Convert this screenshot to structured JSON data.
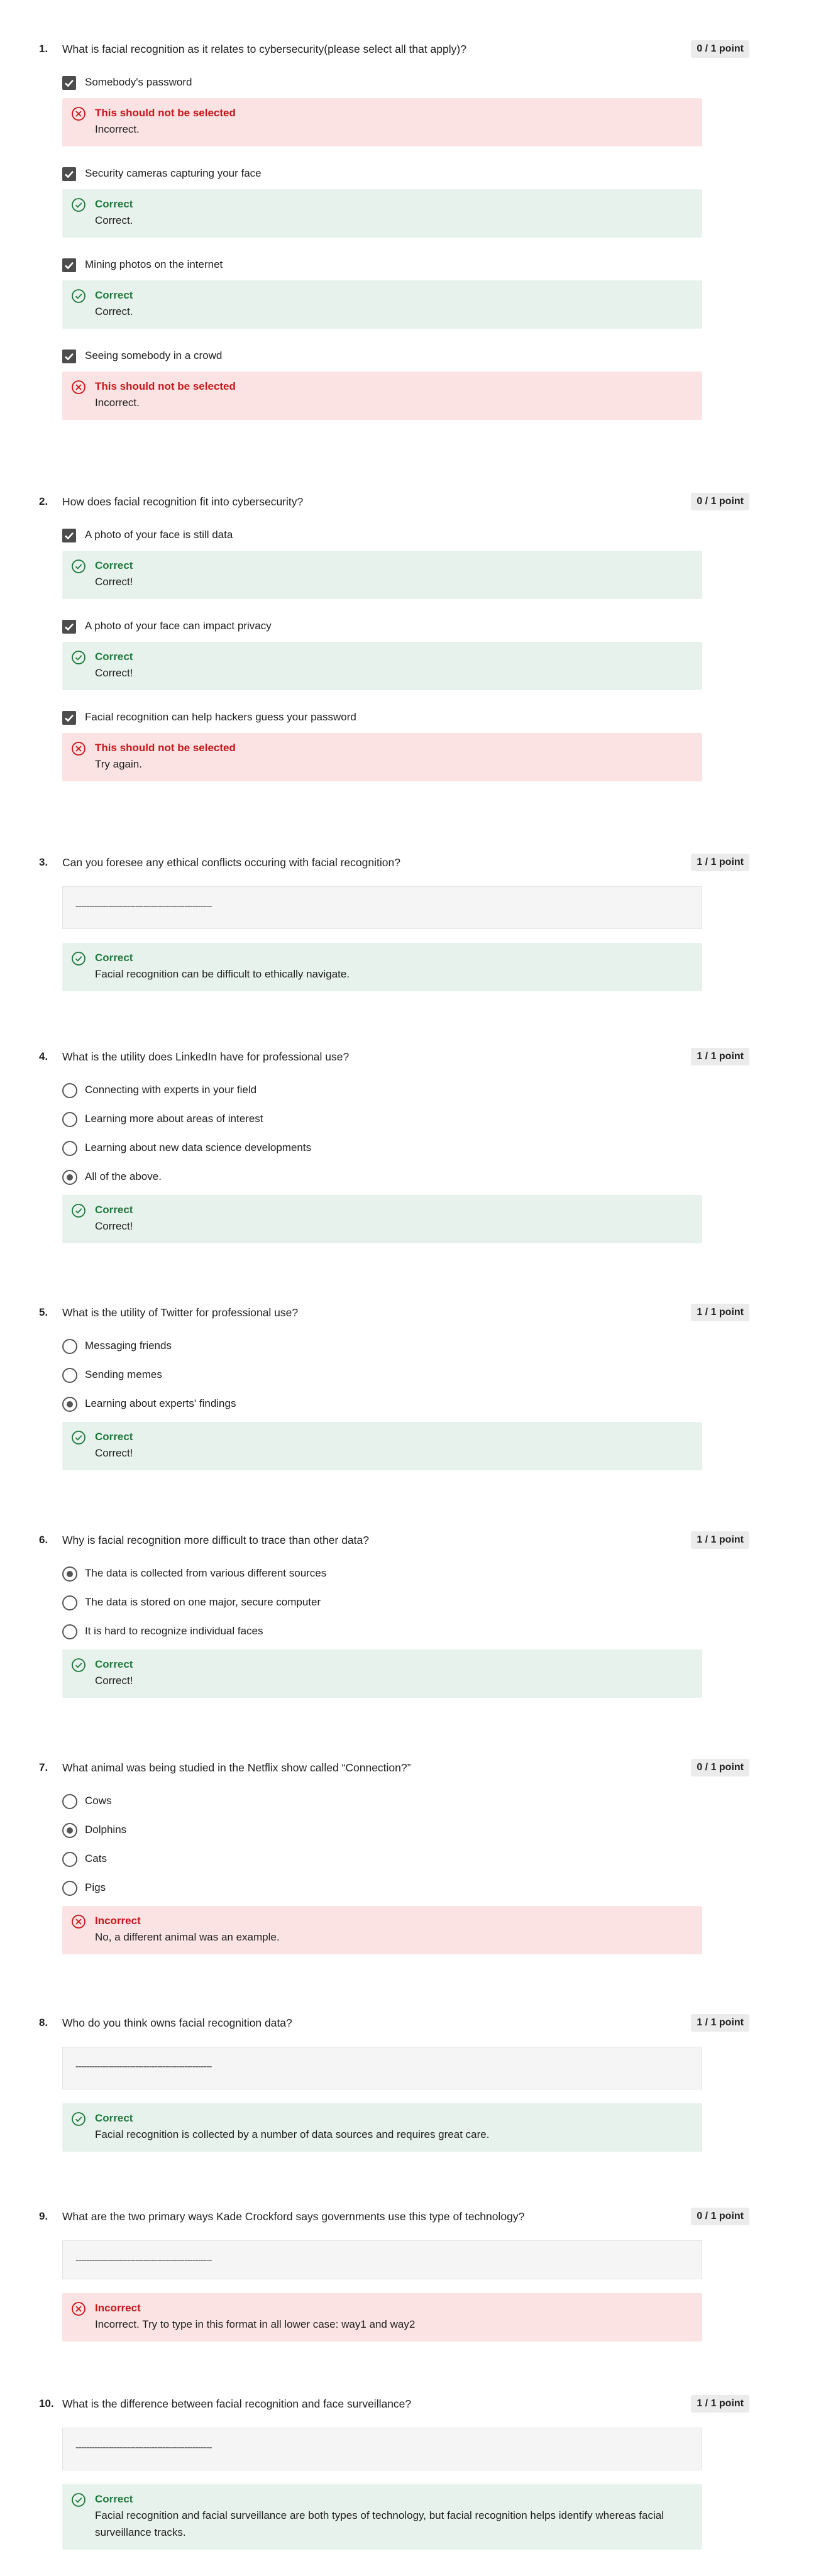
{
  "colors": {
    "correct_bg": "#e8f2ed",
    "incorrect_bg": "#fbe3e3",
    "correct_text": "#1f7a3c",
    "incorrect_text": "#c8171c"
  },
  "questions": [
    {
      "num": "1.",
      "text": "What is facial recognition as it relates to cybersecurity(please select all that apply)?",
      "score": "0 / 1 point",
      "options": [
        {
          "label": "Somebody's password",
          "fb_title": "This should not be selected",
          "fb_text": "Incorrect."
        },
        {
          "label": "Security cameras capturing your face",
          "fb_title": "Correct",
          "fb_text": "Correct."
        },
        {
          "label": "Mining photos on the internet",
          "fb_title": "Correct",
          "fb_text": "Correct."
        },
        {
          "label": "Seeing somebody in a crowd",
          "fb_title": "This should not be selected",
          "fb_text": "Incorrect."
        }
      ]
    },
    {
      "num": "2.",
      "text": "How does facial recognition fit into cybersecurity?",
      "score": "0 / 1 point",
      "options": [
        {
          "label": "A photo of your face is still data",
          "fb_title": "Correct",
          "fb_text": "Correct!"
        },
        {
          "label": "A photo of your face can impact privacy",
          "fb_title": "Correct",
          "fb_text": "Correct!"
        },
        {
          "label": "Facial recognition can help hackers guess your password",
          "fb_title": "This should not be selected",
          "fb_text": "Try again."
        }
      ]
    },
    {
      "num": "3.",
      "text": "Can you foresee any ethical conflicts occuring with facial recognition?",
      "score": "1 / 1 point",
      "answer": "--------------------------------------------------",
      "fb_title": "Correct",
      "fb_text": "Facial recognition can be difficult to ethically navigate."
    },
    {
      "num": "4.",
      "text": "What is the utility does LinkedIn have for professional use?",
      "score": "1 / 1 point",
      "options": [
        "Connecting with experts in your field",
        "Learning more about areas of interest",
        "Learning about new data science developments",
        "All of the above."
      ],
      "fb_title": "Correct",
      "fb_text": "Correct!"
    },
    {
      "num": "5.",
      "text": "What is the utility of Twitter for professional use?",
      "score": "1 / 1 point",
      "options": [
        "Messaging friends",
        "Sending memes",
        "Learning about experts' findings"
      ],
      "fb_title": "Correct",
      "fb_text": "Correct!"
    },
    {
      "num": "6.",
      "text": "Why is facial recognition more difficult to trace than other data?",
      "score": "1 / 1 point",
      "options": [
        "The data is collected from various different sources",
        "The data is stored on one major, secure computer",
        "It is hard to recognize individual faces"
      ],
      "fb_title": "Correct",
      "fb_text": "Correct!"
    },
    {
      "num": "7.",
      "text": "What animal was being studied in the Netflix show called “Connection?”",
      "score": "0 / 1 point",
      "options": [
        "Cows",
        "Dolphins",
        "Cats",
        "Pigs"
      ],
      "fb_title": "Incorrect",
      "fb_text": "No, a different animal was an example."
    },
    {
      "num": "8.",
      "text": "Who do you think owns facial recognition data?",
      "score": "1 / 1 point",
      "answer": "--------------------------------------------------",
      "fb_title": "Correct",
      "fb_text": "Facial recognition is collected by a number of data sources and requires great care."
    },
    {
      "num": "9.",
      "text": "What are the two primary ways Kade Crockford says governments use this type of technology?",
      "score": "0 / 1 point",
      "answer": "--------------------------------------------------",
      "fb_title": "Incorrect",
      "fb_text": "Incorrect. Try to type in this format in all lower case: way1 and way2"
    },
    {
      "num": "10.",
      "text": "What is the difference between facial recognition and face surveillance?",
      "score": "1 / 1 point",
      "answer": "--------------------------------------------------",
      "fb_title": "Correct",
      "fb_text": "Facial recognition and facial surveillance are both types of technology, but facial recognition helps identify whereas facial surveillance tracks."
    }
  ]
}
